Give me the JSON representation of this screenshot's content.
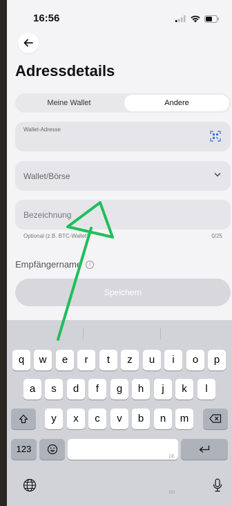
{
  "status": {
    "time": "16:56"
  },
  "page": {
    "title": "Adressdetails"
  },
  "tabs": {
    "mine": "Meine Wallet",
    "other": "Andere"
  },
  "fields": {
    "wallet_address_label": "Wallet-Adresse",
    "exchange_placeholder": "Wallet/Börse",
    "name_placeholder": "Bezeichnung",
    "name_hint": "Optional (z.B. BTC-Wallet)",
    "name_count": "0/25"
  },
  "recipient_label": "Empfängername",
  "save_label": "Speichern",
  "keyboard": {
    "row1": [
      "q",
      "w",
      "e",
      "r",
      "t",
      "z",
      "u",
      "i",
      "o",
      "p"
    ],
    "row2": [
      "a",
      "s",
      "d",
      "f",
      "g",
      "h",
      "j",
      "k",
      "l"
    ],
    "row3": [
      "y",
      "x",
      "c",
      "v",
      "b",
      "n",
      "m"
    ],
    "numbers_key": "123",
    "space_hint": "DE EN"
  },
  "colors": {
    "annotation_arrow": "#1fbf5a"
  }
}
